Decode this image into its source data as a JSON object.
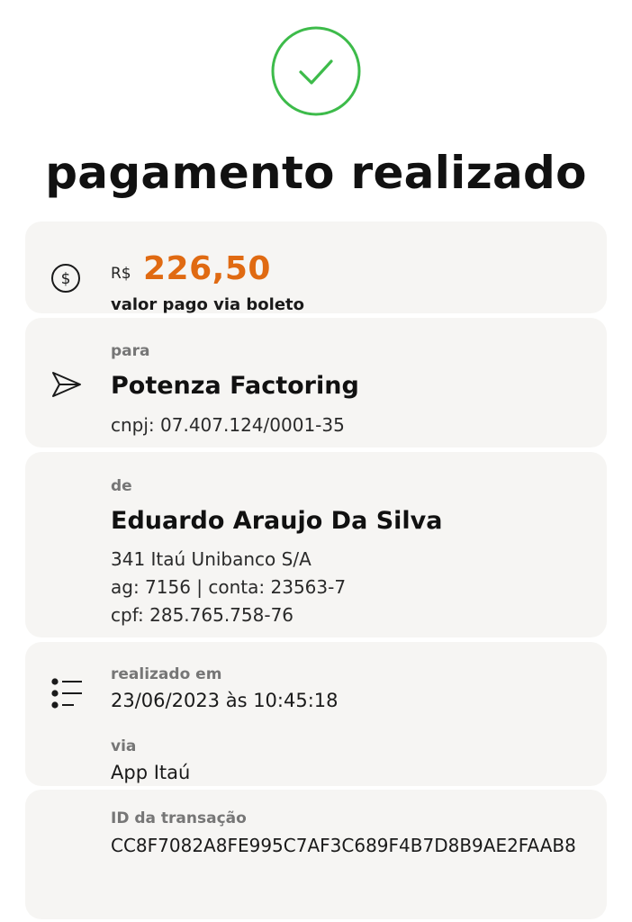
{
  "header": {
    "title": "pagamento realizado",
    "icon": "check-circle-icon",
    "accent_color": "#3dbb4a"
  },
  "amount_card": {
    "icon": "dollar-circle-icon",
    "currency": "R$",
    "amount": "226,50",
    "amount_color": "#e06a12",
    "caption": "valor pago via boleto"
  },
  "recipient_card": {
    "icon": "send-arrow-icon",
    "label": "para",
    "name": "Potenza Factoring",
    "document": "cnpj: 07.407.124/0001-35"
  },
  "payer_card": {
    "label": "de",
    "name": "Eduardo Araujo Da Silva",
    "bank": "341 Itaú Unibanco S/A",
    "account": "ag: 7156 | conta: 23563-7",
    "document": "cpf: 285.765.758-76"
  },
  "details_card": {
    "icon": "list-icon",
    "date_label": "realizado em",
    "date_value": "23/06/2023 às 10:45:18",
    "channel_label": "via",
    "channel_value": "App Itaú"
  },
  "transaction_card": {
    "label": "ID da transação",
    "id": "CC8F7082A8FE995C7AF3C689F4B7D8B9AE2FAAB8"
  }
}
